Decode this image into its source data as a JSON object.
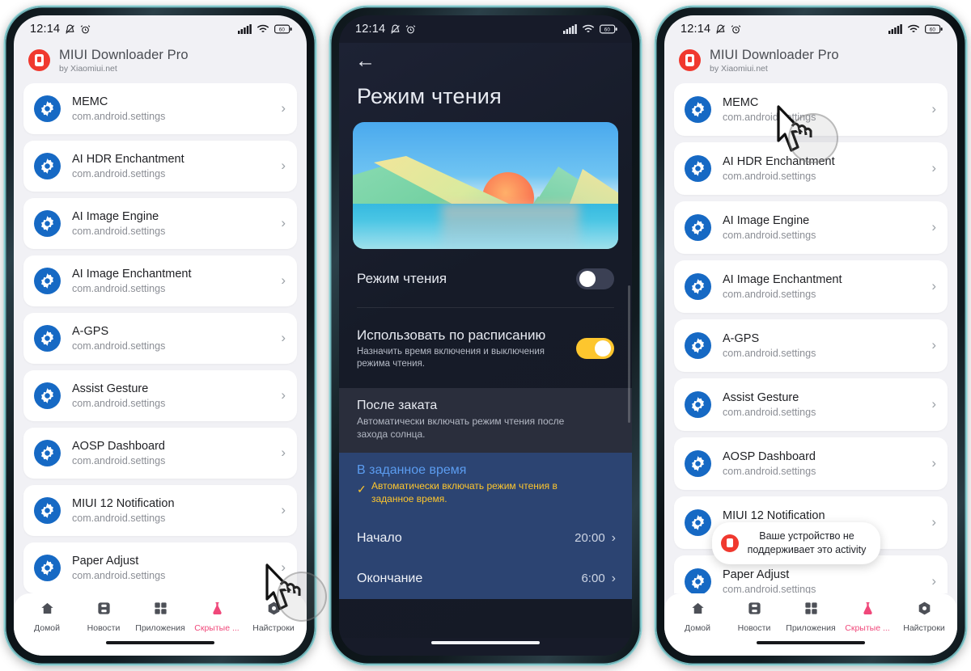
{
  "app": {
    "title": "MIUI Downloader Pro",
    "subtitle": "by Xiaomiui.net",
    "logo_icon": "device-red-icon",
    "accent_red": "#f0392f",
    "accent_pink": "#f0487a",
    "gear_blue": "#1669c4"
  },
  "status_bar": {
    "time": "12:14",
    "silent_icon": "bell-muted-icon",
    "alarm_icon": "alarm-clock-icon",
    "signal_icon": "cellular-signal-icon",
    "wifi_icon": "wifi-icon",
    "battery_icon": "battery-icon",
    "battery_level": "60"
  },
  "app_list": {
    "package": "com.android.settings",
    "items": [
      {
        "title": "MEMC",
        "sub": "com.android.settings",
        "chevron": "chevron-right-icon"
      },
      {
        "title": "AI HDR Enchantment",
        "sub": "com.android.settings",
        "chevron": "chevron-right-icon"
      },
      {
        "title": "AI Image Engine",
        "sub": "com.android.settings",
        "chevron": "chevron-right-icon"
      },
      {
        "title": "AI Image Enchantment",
        "sub": "com.android.settings",
        "chevron": "chevron-right-icon"
      },
      {
        "title": "A-GPS",
        "sub": "com.android.settings",
        "chevron": "chevron-right-icon"
      },
      {
        "title": "Assist Gesture",
        "sub": "com.android.settings",
        "chevron": "chevron-right-icon"
      },
      {
        "title": "AOSP Dashboard",
        "sub": "com.android.settings",
        "chevron": "chevron-right-icon"
      },
      {
        "title": "MIUI 12 Notification",
        "sub": "com.android.settings",
        "chevron": "chevron-right-icon"
      },
      {
        "title": "Paper Adjust",
        "sub": "com.android.settings",
        "chevron": "chevron-right-icon"
      }
    ]
  },
  "bottom_nav": {
    "items": [
      {
        "label": "Домой",
        "icon": "home-icon",
        "active": false
      },
      {
        "label": "Новости",
        "icon": "news-save-icon",
        "active": false
      },
      {
        "label": "Приложения",
        "icon": "apps-grid-icon",
        "active": false
      },
      {
        "label": "Скрытые ...",
        "icon": "flask-icon",
        "active": true
      },
      {
        "label": "Найстроки",
        "icon": "settings-hex-icon",
        "active": false
      }
    ]
  },
  "reading_mode": {
    "back_icon": "arrow-left-icon",
    "title": "Режим чтения",
    "preview_image": "sunset-landscape-wallpaper",
    "toggle_label": "Режим чтения",
    "toggle_state": "off",
    "schedule_label": "Использовать по расписанию",
    "schedule_desc": "Назначить время включения и выключения режима чтения.",
    "schedule_state": "on",
    "options": [
      {
        "title": "После заката",
        "desc": "Автоматически включать режим чтения после захода солнца.",
        "selected": false
      },
      {
        "title": "В заданное время",
        "desc": "Автоматически включать режим чтения в заданное время.",
        "selected": true,
        "check_icon": "checkmark-icon"
      }
    ],
    "times": [
      {
        "label": "Начало",
        "value": "20:00",
        "chevron": "chevron-right-icon"
      },
      {
        "label": "Окончание",
        "value": "6:00",
        "chevron": "chevron-right-icon"
      }
    ]
  },
  "toast": {
    "icon": "device-red-icon",
    "message": "Ваше устройство не поддерживает это activity"
  }
}
